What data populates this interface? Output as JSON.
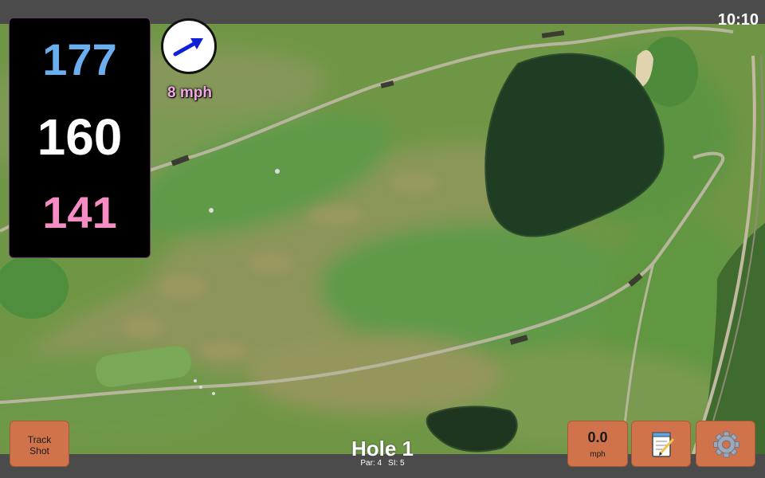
{
  "status_bar": {
    "time": "10:10"
  },
  "distances": {
    "back": {
      "value": "177",
      "color": "#6aaeee"
    },
    "middle": {
      "value": "160",
      "color": "#ffffff"
    },
    "front": {
      "value": "141",
      "color": "#f58cc4"
    }
  },
  "wind": {
    "speed_label": "8 mph",
    "label_color": "#f0a8e4",
    "arrow_color": "#1020d8",
    "direction_icon": "wind-arrow-icon"
  },
  "hole": {
    "title": "Hole 1",
    "par_label": "Par: 4",
    "si_label": "SI: 5"
  },
  "buttons": {
    "track_shot_line1": "Track",
    "track_shot_line2": "Shot",
    "speed_value": "0.0",
    "speed_unit": "mph",
    "notes_icon": "notepad-icon",
    "settings_icon": "gear-icon",
    "color": "#d0734a"
  },
  "map": {
    "type": "satellite-golf-course"
  }
}
